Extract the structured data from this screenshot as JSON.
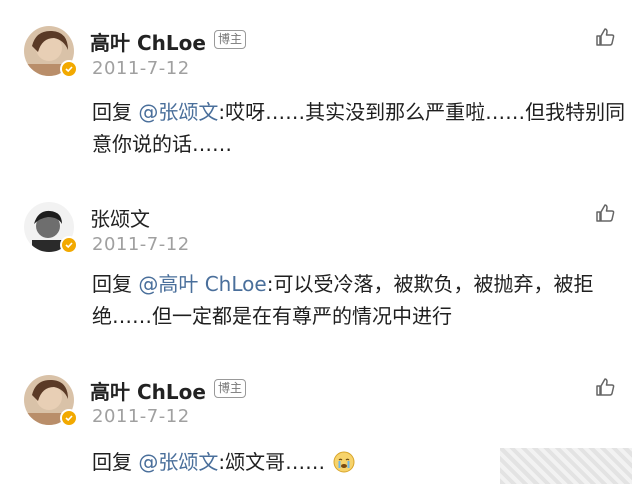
{
  "comments": [
    {
      "author": "高叶 ChLoe",
      "badge": "博主",
      "date": "2011-7-12",
      "reply_prefix": "回复",
      "mention": "@张颂文",
      "text": ":哎呀……其实没到那么严重啦……但我特别同意你说的话……"
    },
    {
      "author": "张颂文",
      "date": "2011-7-12",
      "reply_prefix": "回复",
      "mention": "@高叶 ChLoe",
      "text": ":可以受冷落，被欺负，被抛弃，被拒绝……但一定都是在有尊严的情况中进行"
    },
    {
      "author": "高叶 ChLoe",
      "badge": "博主",
      "date": "2011-7-12",
      "reply_prefix": "回复",
      "mention": "@张颂文",
      "text": ":颂文哥……"
    }
  ],
  "icons": {
    "like": "thumbs-up-icon",
    "verified": "verified-badge-icon",
    "emoji": "crying-face-emoji"
  },
  "colors": {
    "mention": "#4a6f9b",
    "verified": "#f2a900",
    "date": "#a0a0a0"
  }
}
